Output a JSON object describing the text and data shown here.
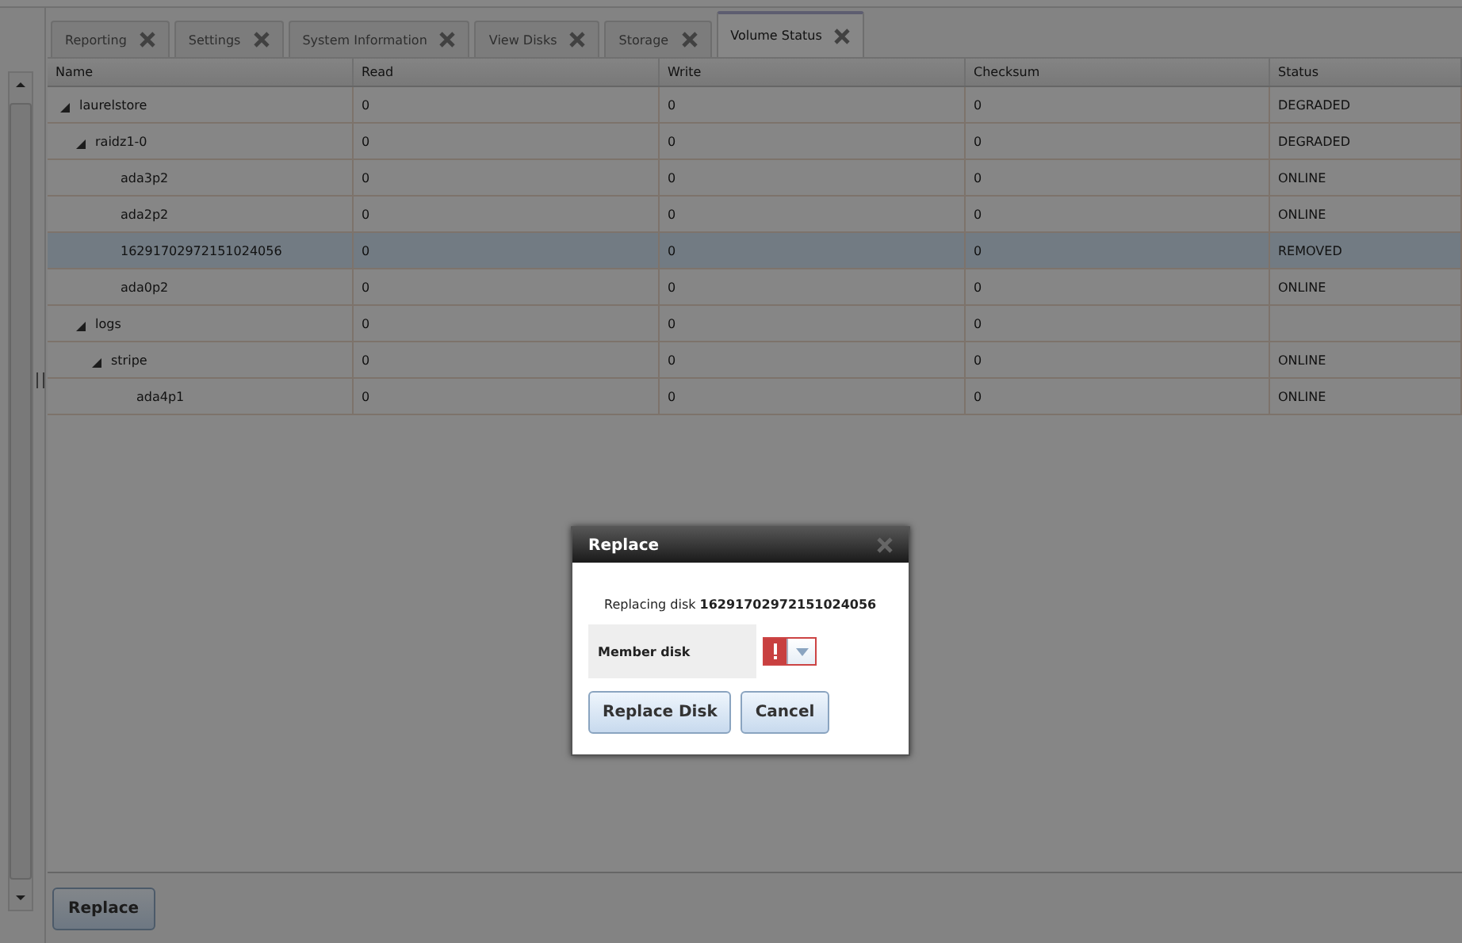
{
  "tabs": [
    {
      "label": "Reporting",
      "selected": false
    },
    {
      "label": "Settings",
      "selected": false
    },
    {
      "label": "System Information",
      "selected": false
    },
    {
      "label": "View Disks",
      "selected": false
    },
    {
      "label": "Storage",
      "selected": false
    },
    {
      "label": "Volume Status",
      "selected": true
    }
  ],
  "table": {
    "columns": [
      "Name",
      "Read",
      "Write",
      "Checksum",
      "Status"
    ],
    "rows": [
      {
        "name": "laurelstore",
        "read": "0",
        "write": "0",
        "checksum": "0",
        "status": "DEGRADED",
        "expanded": true,
        "selected": false,
        "children": [
          {
            "name": "raidz1-0",
            "read": "0",
            "write": "0",
            "checksum": "0",
            "status": "DEGRADED",
            "expanded": true,
            "selected": false,
            "children": [
              {
                "name": "ada3p2",
                "read": "0",
                "write": "0",
                "checksum": "0",
                "status": "ONLINE",
                "selected": false
              },
              {
                "name": "ada2p2",
                "read": "0",
                "write": "0",
                "checksum": "0",
                "status": "ONLINE",
                "selected": false
              },
              {
                "name": "16291702972151024056",
                "read": "0",
                "write": "0",
                "checksum": "0",
                "status": "REMOVED",
                "selected": true
              },
              {
                "name": "ada0p2",
                "read": "0",
                "write": "0",
                "checksum": "0",
                "status": "ONLINE",
                "selected": false
              }
            ]
          },
          {
            "name": "logs",
            "read": "0",
            "write": "0",
            "checksum": "0",
            "expanded": true,
            "selected": false,
            "children": [
              {
                "name": "stripe",
                "read": "0",
                "write": "0",
                "checksum": "0",
                "status": "ONLINE",
                "expanded": true,
                "selected": false,
                "children": [
                  {
                    "name": "ada4p1",
                    "read": "0",
                    "write": "0",
                    "checksum": "0",
                    "status": "ONLINE",
                    "selected": false
                  }
                ]
              }
            ]
          }
        ]
      }
    ]
  },
  "toolbar": {
    "button": "Replace"
  },
  "dialog": {
    "title": "Replace",
    "message": "Replacing disk **16291702972151024056**",
    "field_label": "Member disk",
    "field_error": true,
    "buttons": [
      "Replace Disk",
      "Cancel"
    ]
  }
}
